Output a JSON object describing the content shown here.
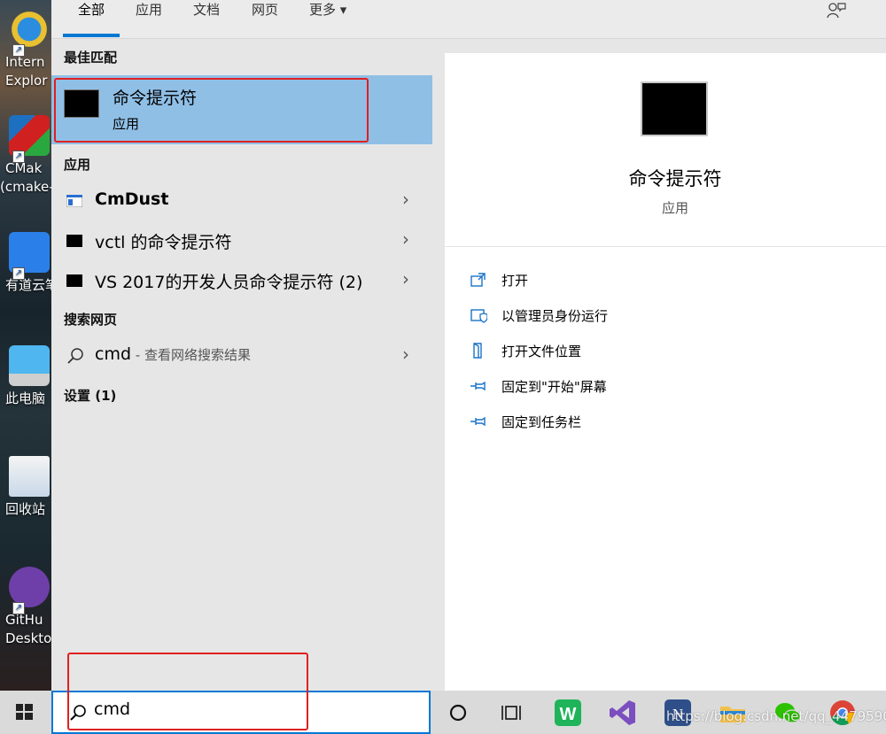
{
  "desktop": {
    "icons": [
      {
        "label_line1": "Intern",
        "label_line2": "Explor"
      },
      {
        "label_line1": "CMak",
        "label_line2": "(cmake-"
      },
      {
        "label_line1": "有道云笔",
        "label_line2": ""
      },
      {
        "label_line1": "此电脑",
        "label_line2": ""
      },
      {
        "label_line1": "回收站",
        "label_line2": ""
      },
      {
        "label_line1": "GitHu",
        "label_line2": "Deskto"
      }
    ]
  },
  "tabs": [
    {
      "label": "全部",
      "active": true
    },
    {
      "label": "应用"
    },
    {
      "label": "文档"
    },
    {
      "label": "网页"
    },
    {
      "label": "更多 ▾"
    }
  ],
  "left": {
    "best_match_heading": "最佳匹配",
    "best_match": {
      "name": "命令提示符",
      "type": "应用"
    },
    "apps_heading": "应用",
    "apps": [
      {
        "label": "CmDust"
      },
      {
        "label": "vctl 的命令提示符"
      },
      {
        "label": "VS 2017的开发人员命令提示符 (2)"
      }
    ],
    "web_heading": "搜索网页",
    "web_result": {
      "query": "cmd",
      "hint": " - 查看网络搜索结果"
    },
    "settings_heading": "设置 (1)"
  },
  "right": {
    "name": "命令提示符",
    "type": "应用",
    "actions": [
      {
        "label": "打开",
        "icon": "open-icon"
      },
      {
        "label": "以管理员身份运行",
        "icon": "shield-icon"
      },
      {
        "label": "打开文件位置",
        "icon": "file-location-icon"
      },
      {
        "label": "固定到\"开始\"屏幕",
        "icon": "pin-icon"
      },
      {
        "label": "固定到任务栏",
        "icon": "pin-icon"
      }
    ]
  },
  "taskbar": {
    "search_value": "cmd",
    "icons": [
      "cortana-icon",
      "task-view-icon",
      "wps-icon",
      "visual-studio-icon",
      "typora-icon",
      "file-explorer-icon",
      "wechat-icon",
      "chrome-icon"
    ]
  },
  "watermark": "https://blog.csdn.net/qq_44795907"
}
